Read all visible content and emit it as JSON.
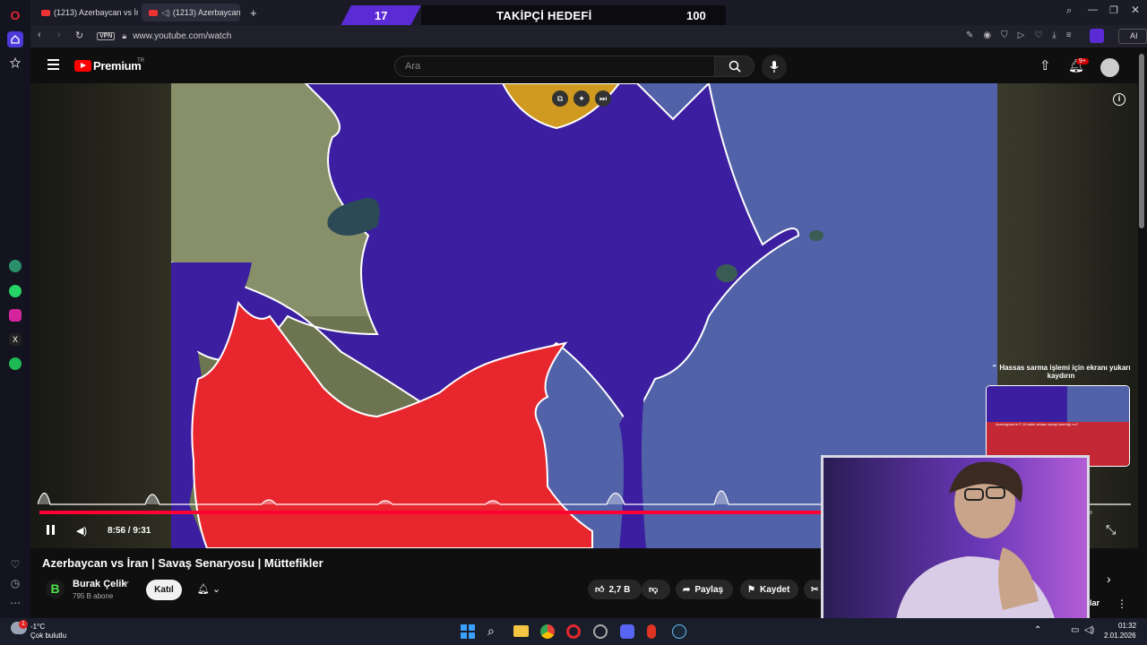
{
  "browser": {
    "tabs": [
      {
        "label": "(1213) Azerbaycan vs İran"
      },
      {
        "label": "(1213) Azerbaycan vs"
      }
    ],
    "address": {
      "vpn": "VPN",
      "url": "www.youtube.com/watch"
    },
    "ai_label": "AI"
  },
  "overlay": {
    "current": "17",
    "title": "TAKİPÇİ HEDEFİ",
    "target": "100"
  },
  "youtube": {
    "logo_text": "Premium",
    "logo_region": "TR",
    "search_placeholder": "Ara",
    "notif_badge": "9+"
  },
  "player": {
    "time": "8:56 / 9:31",
    "progress_fraction": 0.94,
    "tooltip": "Hassas sarma işlemi için ekranı yukarı kaydırın",
    "preview_caption": "Azerbaycan'ın F-16 satın alması savaş hazırlığı mı?"
  },
  "video": {
    "title": "Azerbaycan vs İran | Savaş Senaryosu | Müttefikler",
    "channel": "Burak Çelik",
    "subscribers": "795 B abone",
    "join": "Katıl",
    "likes": "2,7 B",
    "share": "Paylaş",
    "save": "Kaydet",
    "partial_text": "klar"
  },
  "taskbar": {
    "temp": "-1°C",
    "weather": "Çok bulutlu",
    "time": "01:32",
    "date": "2.01.2026",
    "weather_badge": "1"
  },
  "colors": {
    "red": "#e8262e",
    "purple": "#3b1fa0",
    "sea": "#5262a8",
    "overlay_purple": "#5b2bd6"
  }
}
